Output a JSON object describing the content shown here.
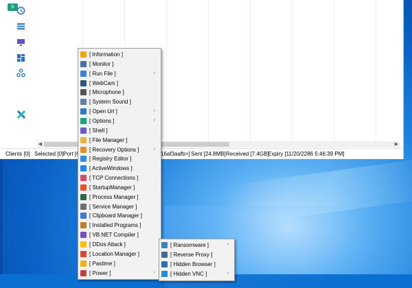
{
  "sidebar": {
    "badge": "0",
    "icons": [
      "history-icon",
      "list-icon",
      "monitor-icon",
      "dashboard-icon",
      "share-icon",
      "x-logo-icon"
    ]
  },
  "status_bar": {
    "clients": "Clients [0]",
    "selected": "Selected [0]",
    "port": "Port [6",
    "key": "16af3aafb>]",
    "sent": "Sent [24.8MB]",
    "received": "Received [7.4GB]",
    "expiry": "Expiry [11/20/2286 5:46:39 PM]"
  },
  "context_menu": {
    "items": [
      {
        "label": "[ Information ]",
        "icon": "info-icon",
        "color": "#f0a800",
        "submenu": false
      },
      {
        "label": "[ Monitor ]",
        "icon": "monitor-icon",
        "color": "#4a6fa5",
        "submenu": false
      },
      {
        "label": "[ Run File ]",
        "icon": "run-file-icon",
        "color": "#3d7ed6",
        "submenu": true
      },
      {
        "label": "[ WebCam ]",
        "icon": "webcam-icon",
        "color": "#335577",
        "submenu": false
      },
      {
        "label": "[ Microphone ]",
        "icon": "microphone-icon",
        "color": "#555555",
        "submenu": false
      },
      {
        "label": "[ System Sound ]",
        "icon": "speaker-icon",
        "color": "#5d7fa8",
        "submenu": false
      },
      {
        "label": "[ Open Url ]",
        "icon": "globe-icon",
        "color": "#2e78c8",
        "submenu": true
      },
      {
        "label": "[ Options ]",
        "icon": "options-icon",
        "color": "#1fa37a",
        "submenu": true
      },
      {
        "label": "[ Shell ]",
        "icon": "code-icon",
        "color": "#6a5acd",
        "submenu": false
      },
      {
        "label": "[ File Manager ]",
        "icon": "folder-icon",
        "color": "#e8b43a",
        "submenu": false
      },
      {
        "label": "[ Recovery Options ]",
        "icon": "wrench-icon",
        "color": "#e58e26",
        "submenu": true
      },
      {
        "label": "[ Registry Editor ]",
        "icon": "registry-icon",
        "color": "#2f8fd8",
        "submenu": false
      },
      {
        "label": "[ ActiveWindows ]",
        "icon": "windows-icon",
        "color": "#1e88e5",
        "submenu": false
      },
      {
        "label": "[ TCP Connections ]",
        "icon": "network-icon",
        "color": "#d94a6a",
        "submenu": false
      },
      {
        "label": "[ StartupManager ]",
        "icon": "startup-icon",
        "color": "#e8542f",
        "submenu": false
      },
      {
        "label": "[ Process Manager ]",
        "icon": "process-icon",
        "color": "#2b6a3f",
        "submenu": false
      },
      {
        "label": "[ Service Manager ]",
        "icon": "gears-icon",
        "color": "#6f6f6f",
        "submenu": false
      },
      {
        "label": "[ Clipboard Manager ]",
        "icon": "clipboard-icon",
        "color": "#3a7bd5",
        "submenu": false
      },
      {
        "label": "[ Installed Programs ]",
        "icon": "package-icon",
        "color": "#c27a2c",
        "submenu": false
      },
      {
        "label": "[ VB.NET Compiler ]",
        "icon": "vb-icon",
        "color": "#7a4fbf",
        "submenu": false
      },
      {
        "label": "[ DDos Attack ]",
        "icon": "lightning-icon",
        "color": "#f2c200",
        "submenu": false
      },
      {
        "label": "[ Location Manager ]",
        "icon": "location-icon",
        "color": "#d9452f",
        "submenu": false
      },
      {
        "label": "[ Pastime ]",
        "icon": "crown-icon",
        "color": "#f0b400",
        "submenu": false
      },
      {
        "label": "[ Power ]",
        "icon": "power-icon",
        "color": "#c04040",
        "submenu": true
      }
    ]
  },
  "submenu": {
    "items": [
      {
        "label": "[ Ransomware ]",
        "icon": "ransomware-icon",
        "color": "#3f7fbf",
        "submenu": true
      },
      {
        "label": "[ Reverse Proxy ]",
        "icon": "proxy-icon",
        "color": "#4a6a8a",
        "submenu": false
      },
      {
        "label": "[ Hidden Browser ]",
        "icon": "browser-icon",
        "color": "#2f6fb0",
        "submenu": false
      },
      {
        "label": "[ Hidden VNC ]",
        "icon": "vnc-icon",
        "color": "#2a8ad0",
        "submenu": true
      }
    ]
  }
}
